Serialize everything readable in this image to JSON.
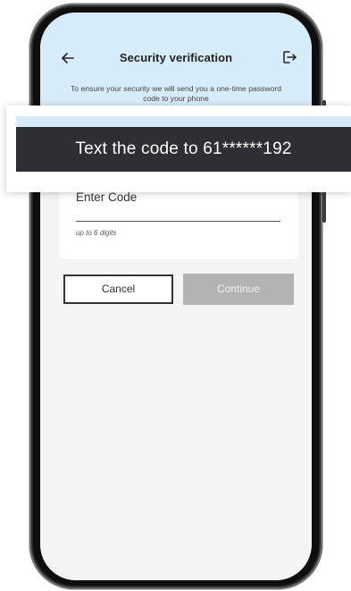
{
  "header": {
    "title": "Security verification",
    "back_icon": "arrow-left-icon",
    "logout_icon": "logout-icon",
    "background_color": "#d7ecfa"
  },
  "info": {
    "text": "To ensure your security we will send you a one-time password code to your phone"
  },
  "code_field": {
    "label": "Enter Code",
    "hint": "up to 6 digits"
  },
  "actions": {
    "cancel_label": "Cancel",
    "continue_label": "Continue",
    "continue_color": "#b3b3b3"
  },
  "banner": {
    "message": "Text the code to 61******192",
    "background_color": "#2c2f33"
  }
}
